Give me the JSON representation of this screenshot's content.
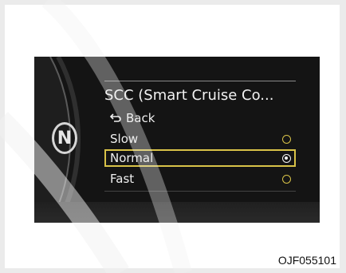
{
  "menu": {
    "title": "SCC (Smart Cruise Co...",
    "back_label": "Back",
    "options": [
      {
        "label": "Slow",
        "selected": false
      },
      {
        "label": "Normal",
        "selected": true
      },
      {
        "label": "Fast",
        "selected": false
      }
    ]
  },
  "gear_indicator": "N",
  "figure_code": "OJF055101",
  "colors": {
    "screen_bg": "#141414",
    "highlight": "#d8c248",
    "text": "#f0f0f0"
  },
  "icons": {
    "back": "return-arrow-icon",
    "radio_off": "radio-unselected-icon",
    "radio_on": "radio-selected-icon"
  }
}
